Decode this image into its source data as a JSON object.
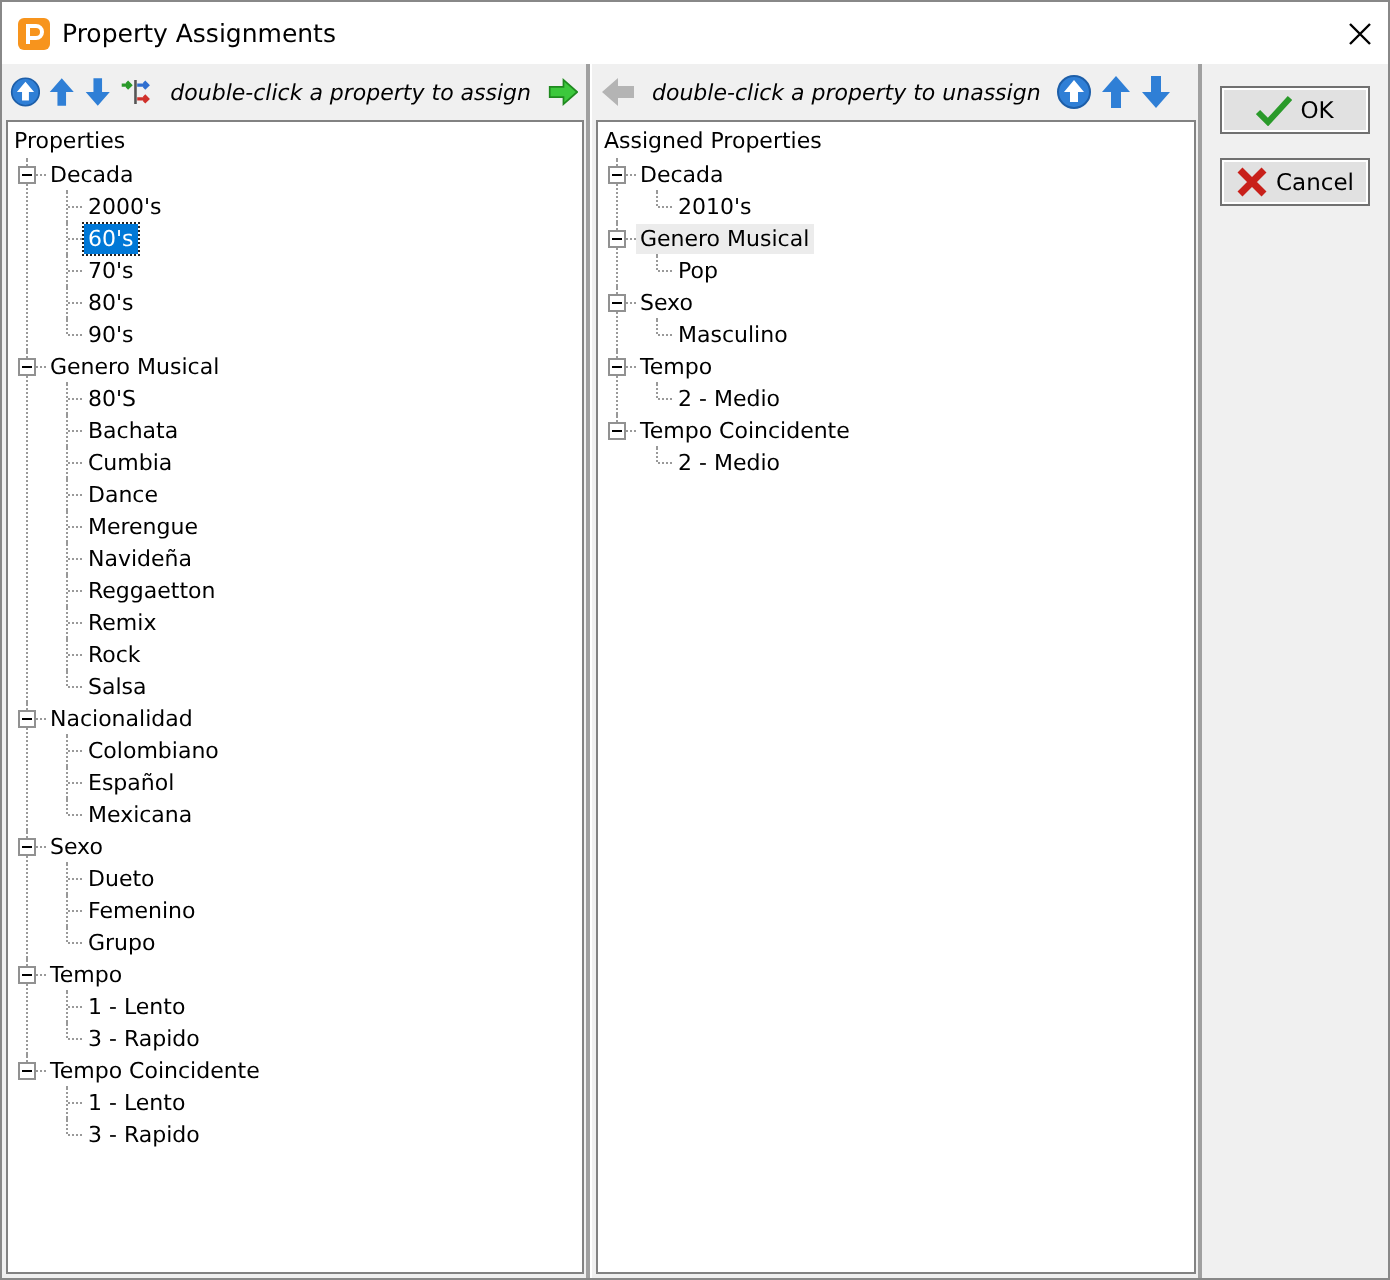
{
  "window": {
    "title": "Property Assignments"
  },
  "left_panel": {
    "toolbar": [
      {
        "kind": "top",
        "disabled": false
      },
      {
        "kind": "up",
        "disabled": false
      },
      {
        "kind": "down",
        "disabled": false
      },
      {
        "kind": "swap",
        "disabled": false
      },
      {
        "kind": "hint",
        "text": "double-click a property to assign"
      },
      {
        "kind": "forward",
        "disabled": false
      }
    ],
    "tree": {
      "title": "Properties",
      "focused": true,
      "nodes": [
        {
          "label": "Decada",
          "expanded": true,
          "selected": false,
          "children": [
            {
              "label": "2000's",
              "selected": false
            },
            {
              "label": "60's",
              "selected": true
            },
            {
              "label": "70's",
              "selected": false
            },
            {
              "label": "80's",
              "selected": false
            },
            {
              "label": "90's",
              "selected": false
            }
          ]
        },
        {
          "label": "Genero Musical",
          "expanded": true,
          "selected": false,
          "children": [
            {
              "label": "80'S",
              "selected": false
            },
            {
              "label": "Bachata",
              "selected": false
            },
            {
              "label": "Cumbia",
              "selected": false
            },
            {
              "label": "Dance",
              "selected": false
            },
            {
              "label": "Merengue",
              "selected": false
            },
            {
              "label": "Navideña",
              "selected": false
            },
            {
              "label": "Reggaetton",
              "selected": false
            },
            {
              "label": "Remix",
              "selected": false
            },
            {
              "label": "Rock",
              "selected": false
            },
            {
              "label": "Salsa",
              "selected": false
            }
          ]
        },
        {
          "label": "Nacionalidad",
          "expanded": true,
          "selected": false,
          "children": [
            {
              "label": "Colombiano",
              "selected": false
            },
            {
              "label": "Español",
              "selected": false
            },
            {
              "label": "Mexicana",
              "selected": false
            }
          ]
        },
        {
          "label": "Sexo",
          "expanded": true,
          "selected": false,
          "children": [
            {
              "label": "Dueto",
              "selected": false
            },
            {
              "label": "Femenino",
              "selected": false
            },
            {
              "label": "Grupo",
              "selected": false
            }
          ]
        },
        {
          "label": "Tempo",
          "expanded": true,
          "selected": false,
          "children": [
            {
              "label": "1 - Lento",
              "selected": false
            },
            {
              "label": "3 - Rapido",
              "selected": false
            }
          ]
        },
        {
          "label": "Tempo Coincidente",
          "expanded": true,
          "selected": false,
          "children": [
            {
              "label": "1 - Lento",
              "selected": false
            },
            {
              "label": "3 - Rapido",
              "selected": false
            }
          ]
        }
      ]
    }
  },
  "right_panel": {
    "toolbar": [
      {
        "kind": "back",
        "disabled": true
      },
      {
        "kind": "hint",
        "text": "double-click a property to unassign"
      },
      {
        "kind": "top",
        "disabled": false
      },
      {
        "kind": "up",
        "disabled": false
      },
      {
        "kind": "down",
        "disabled": false
      }
    ],
    "tree": {
      "title": "Assigned Properties",
      "focused": false,
      "nodes": [
        {
          "label": "Decada",
          "expanded": true,
          "selected": false,
          "children": [
            {
              "label": "2010's",
              "selected": false
            }
          ]
        },
        {
          "label": "Genero Musical",
          "expanded": true,
          "selected": true,
          "children": [
            {
              "label": "Pop",
              "selected": false
            }
          ]
        },
        {
          "label": "Sexo",
          "expanded": true,
          "selected": false,
          "children": [
            {
              "label": "Masculino",
              "selected": false
            }
          ]
        },
        {
          "label": "Tempo",
          "expanded": true,
          "selected": false,
          "children": [
            {
              "label": "2 - Medio",
              "selected": false
            }
          ]
        },
        {
          "label": "Tempo Coincidente",
          "expanded": true,
          "selected": false,
          "children": [
            {
              "label": "2 - Medio",
              "selected": false
            }
          ]
        }
      ]
    }
  },
  "buttons": [
    {
      "kind": "ok",
      "label": "OK"
    },
    {
      "kind": "cancel",
      "label": "Cancel"
    }
  ]
}
